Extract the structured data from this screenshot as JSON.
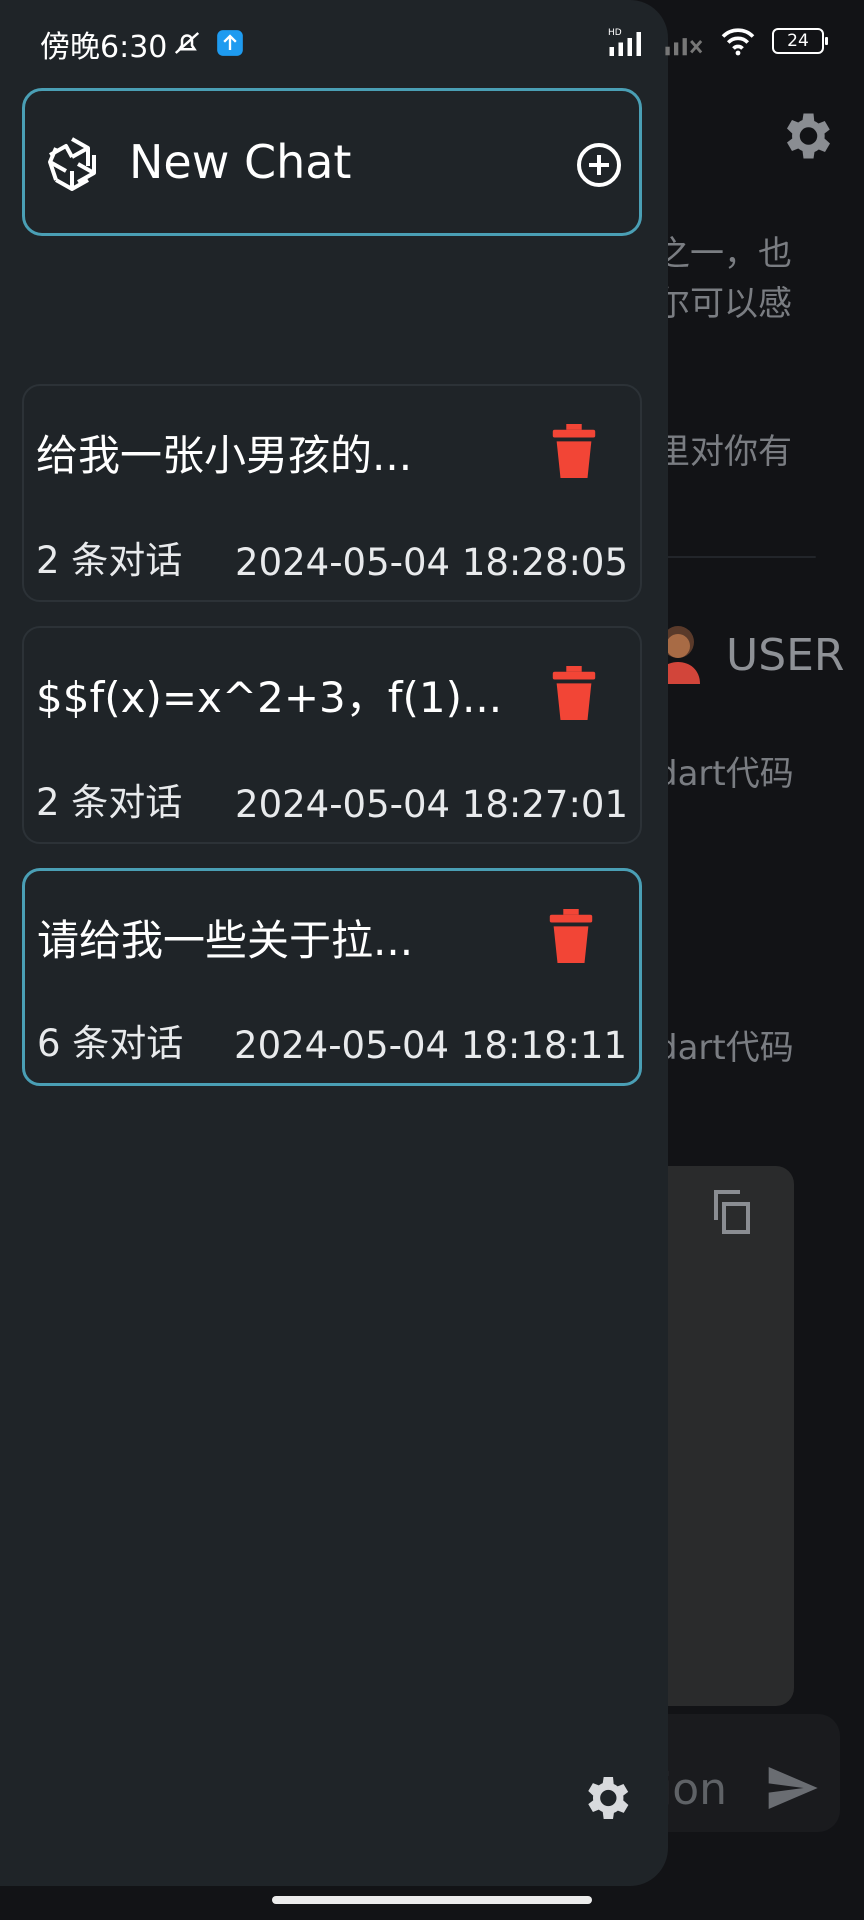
{
  "status_bar": {
    "time": "傍晚6:30",
    "battery": "24"
  },
  "background": {
    "fragment_1": "之一，也",
    "fragment_2": "尔可以感",
    "fragment_3": "里对你有",
    "user_label": "USER",
    "fragment_4": "dart代码",
    "fragment_5": "dart代码",
    "input_placeholder_fragment": "ion"
  },
  "drawer": {
    "new_chat_label": "New Chat",
    "chats": [
      {
        "title": "给我一张小男孩的...",
        "count": "2 条对话",
        "timestamp": "2024-05-04 18:28:05",
        "active": false
      },
      {
        "title": "$$f(x)=x^2+3，f(1)...",
        "count": "2 条对话",
        "timestamp": "2024-05-04 18:27:01",
        "active": false
      },
      {
        "title": "请给我一些关于拉...",
        "count": "6 条对话",
        "timestamp": "2024-05-04 18:18:11",
        "active": true
      }
    ]
  },
  "colors": {
    "accent": "#4a9fb5",
    "delete": "#f24536",
    "drawer_bg": "#1f2428"
  },
  "icons": [
    "openai-logo-icon",
    "add-circle-icon",
    "trash-icon",
    "gear-icon",
    "copy-icon",
    "send-icon"
  ]
}
